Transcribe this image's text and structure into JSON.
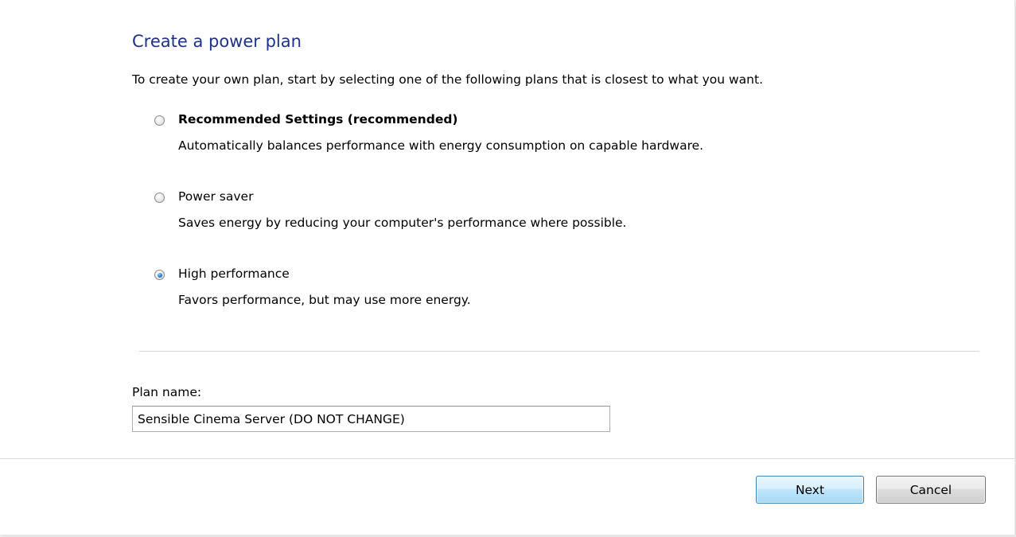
{
  "page": {
    "title": "Create a power plan",
    "intro": "To create your own plan, start by selecting one of the following plans that is closest to what you want."
  },
  "options": [
    {
      "label": "Recommended Settings (recommended)",
      "description": "Automatically balances performance with energy consumption on capable hardware.",
      "selected": false,
      "bold": true
    },
    {
      "label": "Power saver",
      "description": "Saves energy by reducing your computer's performance where possible.",
      "selected": false,
      "bold": false
    },
    {
      "label": "High performance",
      "description": "Favors performance, but may use more energy.",
      "selected": true,
      "bold": false
    }
  ],
  "plan_name": {
    "label": "Plan name:",
    "value": "Sensible Cinema Server (DO NOT CHANGE)"
  },
  "buttons": {
    "next": "Next",
    "cancel": "Cancel"
  },
  "colors": {
    "title": "#1e3287",
    "accent": "#3c7fb1"
  }
}
